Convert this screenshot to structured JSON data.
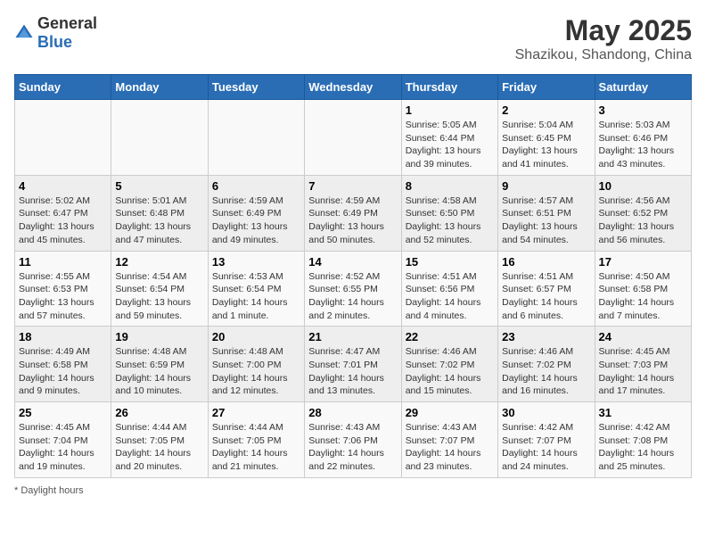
{
  "header": {
    "logo_general": "General",
    "logo_blue": "Blue",
    "month_year": "May 2025",
    "location": "Shazikou, Shandong, China"
  },
  "days_of_week": [
    "Sunday",
    "Monday",
    "Tuesday",
    "Wednesday",
    "Thursday",
    "Friday",
    "Saturday"
  ],
  "weeks": [
    [
      {
        "day": "",
        "info": ""
      },
      {
        "day": "",
        "info": ""
      },
      {
        "day": "",
        "info": ""
      },
      {
        "day": "",
        "info": ""
      },
      {
        "day": "1",
        "info": "Sunrise: 5:05 AM\nSunset: 6:44 PM\nDaylight: 13 hours and 39 minutes."
      },
      {
        "day": "2",
        "info": "Sunrise: 5:04 AM\nSunset: 6:45 PM\nDaylight: 13 hours and 41 minutes."
      },
      {
        "day": "3",
        "info": "Sunrise: 5:03 AM\nSunset: 6:46 PM\nDaylight: 13 hours and 43 minutes."
      }
    ],
    [
      {
        "day": "4",
        "info": "Sunrise: 5:02 AM\nSunset: 6:47 PM\nDaylight: 13 hours and 45 minutes."
      },
      {
        "day": "5",
        "info": "Sunrise: 5:01 AM\nSunset: 6:48 PM\nDaylight: 13 hours and 47 minutes."
      },
      {
        "day": "6",
        "info": "Sunrise: 4:59 AM\nSunset: 6:49 PM\nDaylight: 13 hours and 49 minutes."
      },
      {
        "day": "7",
        "info": "Sunrise: 4:59 AM\nSunset: 6:49 PM\nDaylight: 13 hours and 50 minutes."
      },
      {
        "day": "8",
        "info": "Sunrise: 4:58 AM\nSunset: 6:50 PM\nDaylight: 13 hours and 52 minutes."
      },
      {
        "day": "9",
        "info": "Sunrise: 4:57 AM\nSunset: 6:51 PM\nDaylight: 13 hours and 54 minutes."
      },
      {
        "day": "10",
        "info": "Sunrise: 4:56 AM\nSunset: 6:52 PM\nDaylight: 13 hours and 56 minutes."
      }
    ],
    [
      {
        "day": "11",
        "info": "Sunrise: 4:55 AM\nSunset: 6:53 PM\nDaylight: 13 hours and 57 minutes."
      },
      {
        "day": "12",
        "info": "Sunrise: 4:54 AM\nSunset: 6:54 PM\nDaylight: 13 hours and 59 minutes."
      },
      {
        "day": "13",
        "info": "Sunrise: 4:53 AM\nSunset: 6:54 PM\nDaylight: 14 hours and 1 minute."
      },
      {
        "day": "14",
        "info": "Sunrise: 4:52 AM\nSunset: 6:55 PM\nDaylight: 14 hours and 2 minutes."
      },
      {
        "day": "15",
        "info": "Sunrise: 4:51 AM\nSunset: 6:56 PM\nDaylight: 14 hours and 4 minutes."
      },
      {
        "day": "16",
        "info": "Sunrise: 4:51 AM\nSunset: 6:57 PM\nDaylight: 14 hours and 6 minutes."
      },
      {
        "day": "17",
        "info": "Sunrise: 4:50 AM\nSunset: 6:58 PM\nDaylight: 14 hours and 7 minutes."
      }
    ],
    [
      {
        "day": "18",
        "info": "Sunrise: 4:49 AM\nSunset: 6:58 PM\nDaylight: 14 hours and 9 minutes."
      },
      {
        "day": "19",
        "info": "Sunrise: 4:48 AM\nSunset: 6:59 PM\nDaylight: 14 hours and 10 minutes."
      },
      {
        "day": "20",
        "info": "Sunrise: 4:48 AM\nSunset: 7:00 PM\nDaylight: 14 hours and 12 minutes."
      },
      {
        "day": "21",
        "info": "Sunrise: 4:47 AM\nSunset: 7:01 PM\nDaylight: 14 hours and 13 minutes."
      },
      {
        "day": "22",
        "info": "Sunrise: 4:46 AM\nSunset: 7:02 PM\nDaylight: 14 hours and 15 minutes."
      },
      {
        "day": "23",
        "info": "Sunrise: 4:46 AM\nSunset: 7:02 PM\nDaylight: 14 hours and 16 minutes."
      },
      {
        "day": "24",
        "info": "Sunrise: 4:45 AM\nSunset: 7:03 PM\nDaylight: 14 hours and 17 minutes."
      }
    ],
    [
      {
        "day": "25",
        "info": "Sunrise: 4:45 AM\nSunset: 7:04 PM\nDaylight: 14 hours and 19 minutes."
      },
      {
        "day": "26",
        "info": "Sunrise: 4:44 AM\nSunset: 7:05 PM\nDaylight: 14 hours and 20 minutes."
      },
      {
        "day": "27",
        "info": "Sunrise: 4:44 AM\nSunset: 7:05 PM\nDaylight: 14 hours and 21 minutes."
      },
      {
        "day": "28",
        "info": "Sunrise: 4:43 AM\nSunset: 7:06 PM\nDaylight: 14 hours and 22 minutes."
      },
      {
        "day": "29",
        "info": "Sunrise: 4:43 AM\nSunset: 7:07 PM\nDaylight: 14 hours and 23 minutes."
      },
      {
        "day": "30",
        "info": "Sunrise: 4:42 AM\nSunset: 7:07 PM\nDaylight: 14 hours and 24 minutes."
      },
      {
        "day": "31",
        "info": "Sunrise: 4:42 AM\nSunset: 7:08 PM\nDaylight: 14 hours and 25 minutes."
      }
    ]
  ],
  "footer": "Daylight hours"
}
